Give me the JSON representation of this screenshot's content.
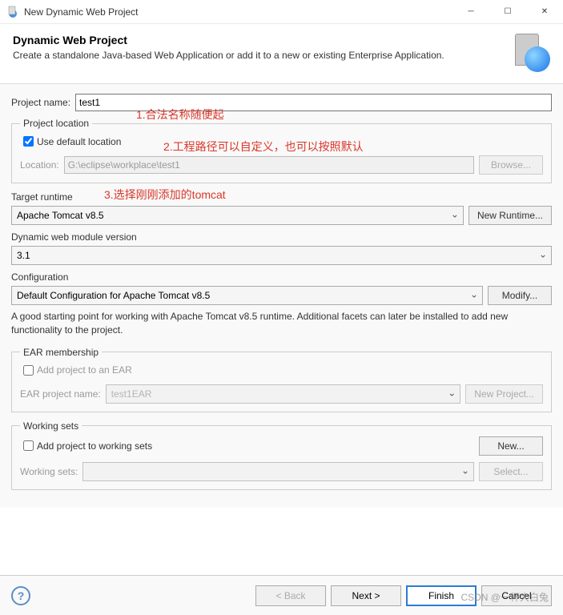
{
  "window": {
    "title": "New Dynamic Web Project"
  },
  "header": {
    "title": "Dynamic Web Project",
    "desc": "Create a standalone Java-based Web Application or add it to a new or existing Enterprise Application."
  },
  "project_name": {
    "label": "Project name:",
    "value": "test1"
  },
  "project_location": {
    "legend": "Project location",
    "use_default": "Use default location",
    "location_label": "Location:",
    "location_value": "G:\\eclipse\\workplace\\test1",
    "browse": "Browse..."
  },
  "target_runtime": {
    "label": "Target runtime",
    "value": "Apache Tomcat v8.5",
    "new_btn": "New Runtime..."
  },
  "web_module": {
    "label": "Dynamic web module version",
    "value": "3.1"
  },
  "config": {
    "label": "Configuration",
    "value": "Default Configuration for Apache Tomcat v8.5",
    "modify": "Modify...",
    "desc": "A good starting point for working with Apache Tomcat v8.5 runtime. Additional facets can later be installed to add new functionality to the project."
  },
  "ear": {
    "legend": "EAR membership",
    "add": "Add project to an EAR",
    "name_label": "EAR project name:",
    "name_value": "test1EAR",
    "new_btn": "New Project..."
  },
  "working_sets": {
    "legend": "Working sets",
    "add": "Add project to working sets",
    "new_btn": "New...",
    "label": "Working sets:",
    "select_btn": "Select..."
  },
  "footer": {
    "back": "< Back",
    "next": "Next >",
    "finish": "Finish",
    "cancel": "Cancel"
  },
  "annotations": {
    "a1": "1.合法名称随便起",
    "a2": "2.工程路径可以自定义，也可以按照默认",
    "a3": "3.选择刚刚添加的tomcat"
  },
  "watermark": "CSDN @一杯大白兔"
}
